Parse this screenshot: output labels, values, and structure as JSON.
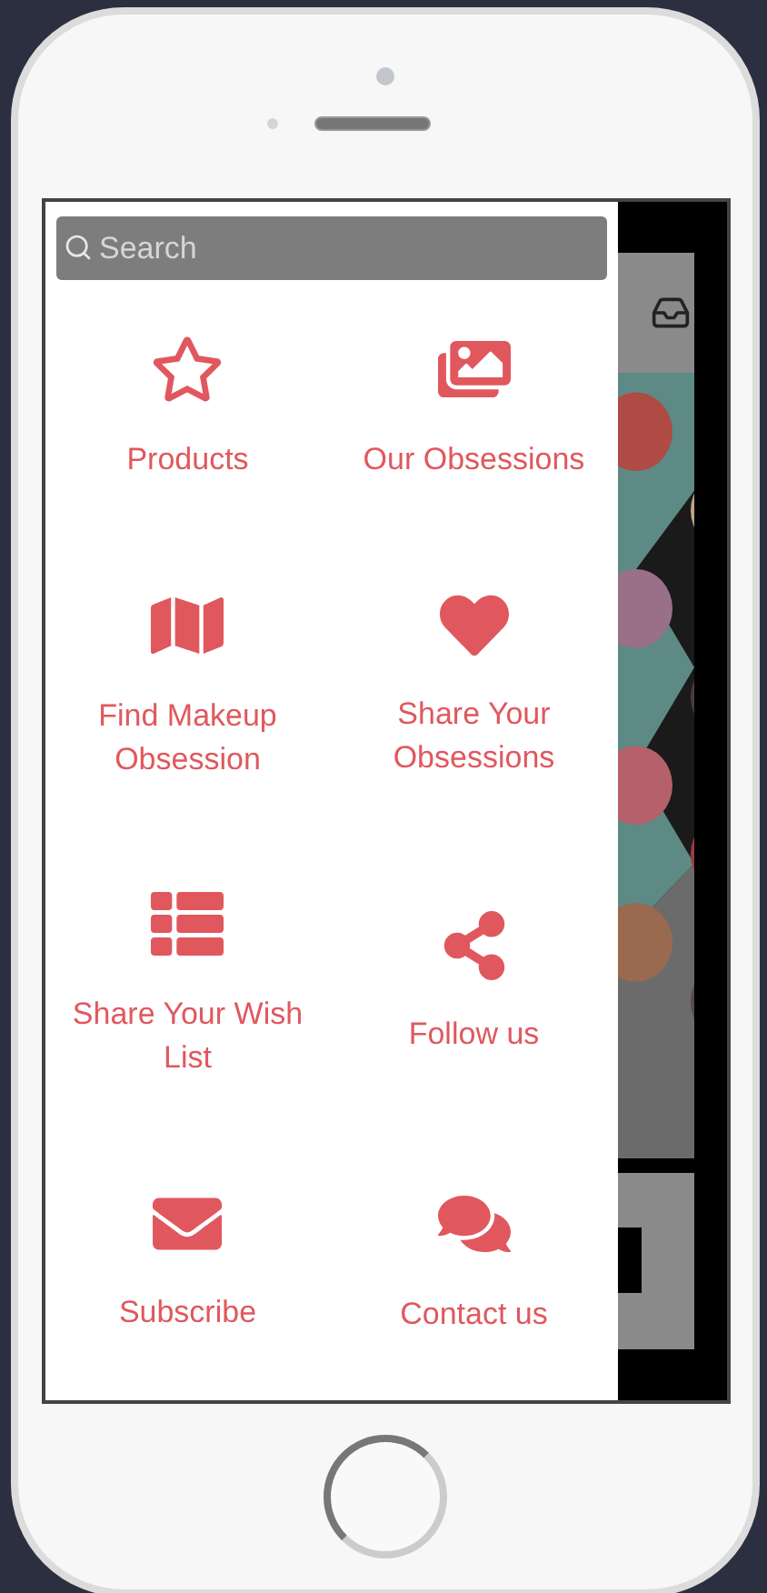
{
  "search": {
    "placeholder": "Search"
  },
  "menu": [
    {
      "label": "Products"
    },
    {
      "label": "Our Obsessions"
    },
    {
      "label": "Find Makeup Obsession"
    },
    {
      "label": "Share Your Obsessions"
    },
    {
      "label": "Share Your Wish List"
    },
    {
      "label": "Follow us"
    },
    {
      "label": "Subscribe"
    },
    {
      "label": "Contact us"
    }
  ]
}
